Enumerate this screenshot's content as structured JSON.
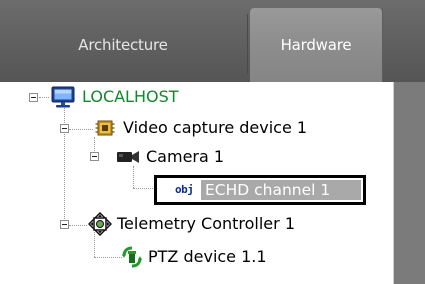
{
  "tabs": [
    {
      "label": "Architecture",
      "active": false
    },
    {
      "label": "Hardware",
      "active": true
    }
  ],
  "tree": {
    "nodes": [
      {
        "label": "LOCALHOST",
        "icon": "server-monitor-icon",
        "expanded": true,
        "color": "#0e8a2b"
      },
      {
        "label": "Video capture device 1",
        "icon": "capture-board-icon",
        "expanded": true
      },
      {
        "label": "Camera 1",
        "icon": "camera-icon",
        "expanded": true
      },
      {
        "label": "ECHD channel 1",
        "icon": "obj-icon",
        "icon_text": "obj",
        "selected": true
      },
      {
        "label": "Telemetry Controller 1",
        "icon": "telemetry-controller-icon",
        "expanded": true
      },
      {
        "label": "PTZ device 1.1",
        "icon": "ptz-device-icon"
      }
    ]
  },
  "colors": {
    "tabbar_bg": "#606060",
    "active_tab_bg": "#8f8f8f",
    "selection_bg": "#a9a9a9",
    "selection_border": "#000000",
    "localhost_text": "#0e8a2b"
  }
}
